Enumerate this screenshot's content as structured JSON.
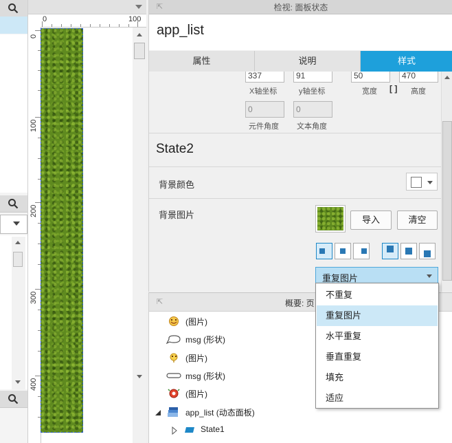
{
  "left_strip": {
    "icons": [
      "search-icon",
      "search-icon",
      "search-icon"
    ]
  },
  "canvas": {
    "ruler_h": [
      "0",
      "100"
    ],
    "ruler_v": [
      "0",
      "100",
      "200",
      "300",
      "400"
    ],
    "widget_fill": "grass-texture"
  },
  "inspector": {
    "header_title": "检视: 面板状态",
    "widget_name": "app_list",
    "tabs": [
      {
        "label": "属性",
        "active": false
      },
      {
        "label": "说明",
        "active": false
      },
      {
        "label": "样式",
        "active": true
      }
    ],
    "position": {
      "x": "337",
      "x_label": "X轴坐标",
      "y": "91",
      "y_label": "y轴坐标",
      "width": "50",
      "width_label": "宽度",
      "height": "470",
      "height_label": "高度",
      "widget_angle": "0",
      "widget_angle_label": "元件角度",
      "text_angle": "0",
      "text_angle_label": "文本角度"
    },
    "state_name": "State2",
    "bg_color_label": "背景颜色",
    "bg_image_label": "背景图片",
    "import_label": "导入",
    "clear_label": "清空",
    "repeat_value": "重复图片"
  },
  "repeat_menu": {
    "options": [
      "不重复",
      "重复图片",
      "水平重复",
      "垂直重复",
      "填充",
      "适应"
    ],
    "selected": "重复图片"
  },
  "outline": {
    "header_title": "概要: 页",
    "items": [
      {
        "label": "(图片)",
        "icon": "emoji-icon"
      },
      {
        "label": "msg (形状)",
        "icon": "speech-bubble-icon"
      },
      {
        "label": "(图片)",
        "icon": "emoji-icon"
      },
      {
        "label": "msg (形状)",
        "icon": "rounded-rect-icon"
      },
      {
        "label": "(图片)",
        "icon": "emoji-icon"
      },
      {
        "label": "app_list (动态面板)",
        "icon": "dynamic-panel-icon"
      },
      {
        "label": "State1",
        "icon": "state-icon"
      }
    ]
  },
  "colors": {
    "accent": "#1ea0db",
    "selection": "#cce8f7",
    "grass": "#5f8a1f"
  }
}
